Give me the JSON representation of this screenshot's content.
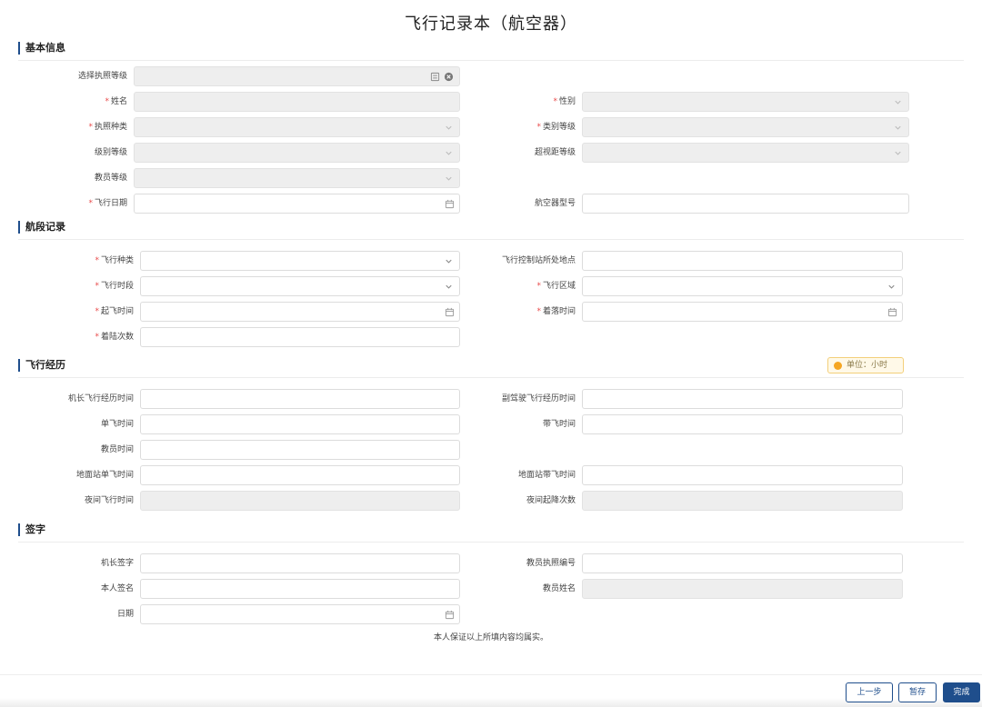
{
  "page": {
    "title": "飞行记录本（航空器）"
  },
  "sections": {
    "basic": "基本信息",
    "leg": "航段记录",
    "experience": "飞行经历",
    "signature": "签字"
  },
  "basic": {
    "license_level": "选择执照等级",
    "name": "姓名",
    "gender": "性别",
    "license_type": "执照种类",
    "category_level": "类别等级",
    "class_level": "级别等级",
    "bvlos_level": "超视距等级",
    "instructor_level": "教员等级",
    "flight_date": "飞行日期",
    "aircraft_model": "航空器型号"
  },
  "leg": {
    "flight_type": "飞行种类",
    "control_location": "飞行控制站所处地点",
    "flight_period": "飞行时段",
    "flight_area": "飞行区域",
    "takeoff_time": "起飞时间",
    "landing_time": "着落时间",
    "landing_count": "着陆次数"
  },
  "experience": {
    "unit": "单位：小时",
    "pic_time": "机长飞行经历时间",
    "copilot_time": "副驾驶飞行经历时间",
    "solo_time": "单飞时间",
    "dual_time": "带飞时间",
    "instructor_time": "教员时间",
    "ground_solo": "地面站单飞时间",
    "ground_dual": "地面站带飞时间",
    "night_time": "夜间飞行时间",
    "night_takeoffs": "夜间起降次数"
  },
  "signature": {
    "pic_sign": "机长签字",
    "instructor_license_no": "教员执照编号",
    "self_sign": "本人签名",
    "instructor_name": "教员姓名",
    "date": "日期"
  },
  "note": "本人保证以上所填内容均属实。",
  "buttons": {
    "prev": "上一步",
    "save": "暂存",
    "finish": "完成"
  },
  "required_mark": "*",
  "colors": {
    "primary": "#1f4e8c",
    "required": "#e94b4b",
    "unit_dot": "#f5a623"
  }
}
